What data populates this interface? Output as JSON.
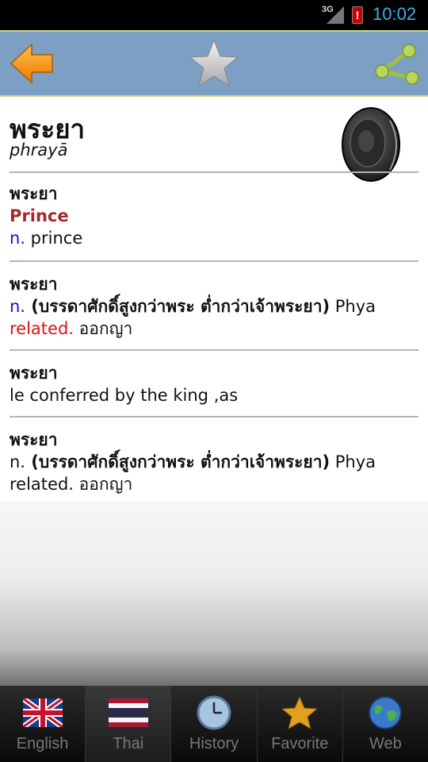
{
  "status_bar": {
    "network": "3G",
    "time": "10:02",
    "battery_alert": "!"
  },
  "toolbar": {
    "back_icon": "back-arrow-icon",
    "favorite_icon": "star-icon",
    "share_icon": "share-icon"
  },
  "header": {
    "word": "พระยา",
    "transliteration": "phrayā",
    "speaker_icon": "speaker-icon"
  },
  "entries": [
    {
      "word": "พระยา",
      "line1": "Prince",
      "line2_pos": "n.",
      "line2_text": " prince"
    },
    {
      "word": "พระยา",
      "pos": "n.",
      "bold_text": " (บรรดาศักดิ์สูงกว่าพระ ต่ำกว่าเจ้าพระยา)",
      "tail": " Phya",
      "related_label": "related.",
      "related_text": " ออกญา"
    },
    {
      "word": "พระยา",
      "line1": "le conferred by the king ,as"
    },
    {
      "word": "พระยา",
      "pos": "n.",
      "bold_text": " (บรรดาศักดิ์สูงกว่าพระ ต่ำกว่าเจ้าพระยา)",
      "tail": " Phya",
      "related_label": "related.",
      "related_text": " ออกญา"
    }
  ],
  "tabs": [
    {
      "label": "English",
      "icon": "uk-flag-icon",
      "active": false
    },
    {
      "label": "Thai",
      "icon": "thai-flag-icon",
      "active": true
    },
    {
      "label": "History",
      "icon": "clock-icon",
      "active": false
    },
    {
      "label": "Favorite",
      "icon": "star-icon",
      "active": false
    },
    {
      "label": "Web",
      "icon": "globe-icon",
      "active": false
    }
  ],
  "colors": {
    "toolbar_bg": "#7c9fc3",
    "pos_blue": "#1010d8",
    "related_red": "#dd1111",
    "sense_maroon": "#a52a2a",
    "time_blue": "#3ab0e5"
  }
}
